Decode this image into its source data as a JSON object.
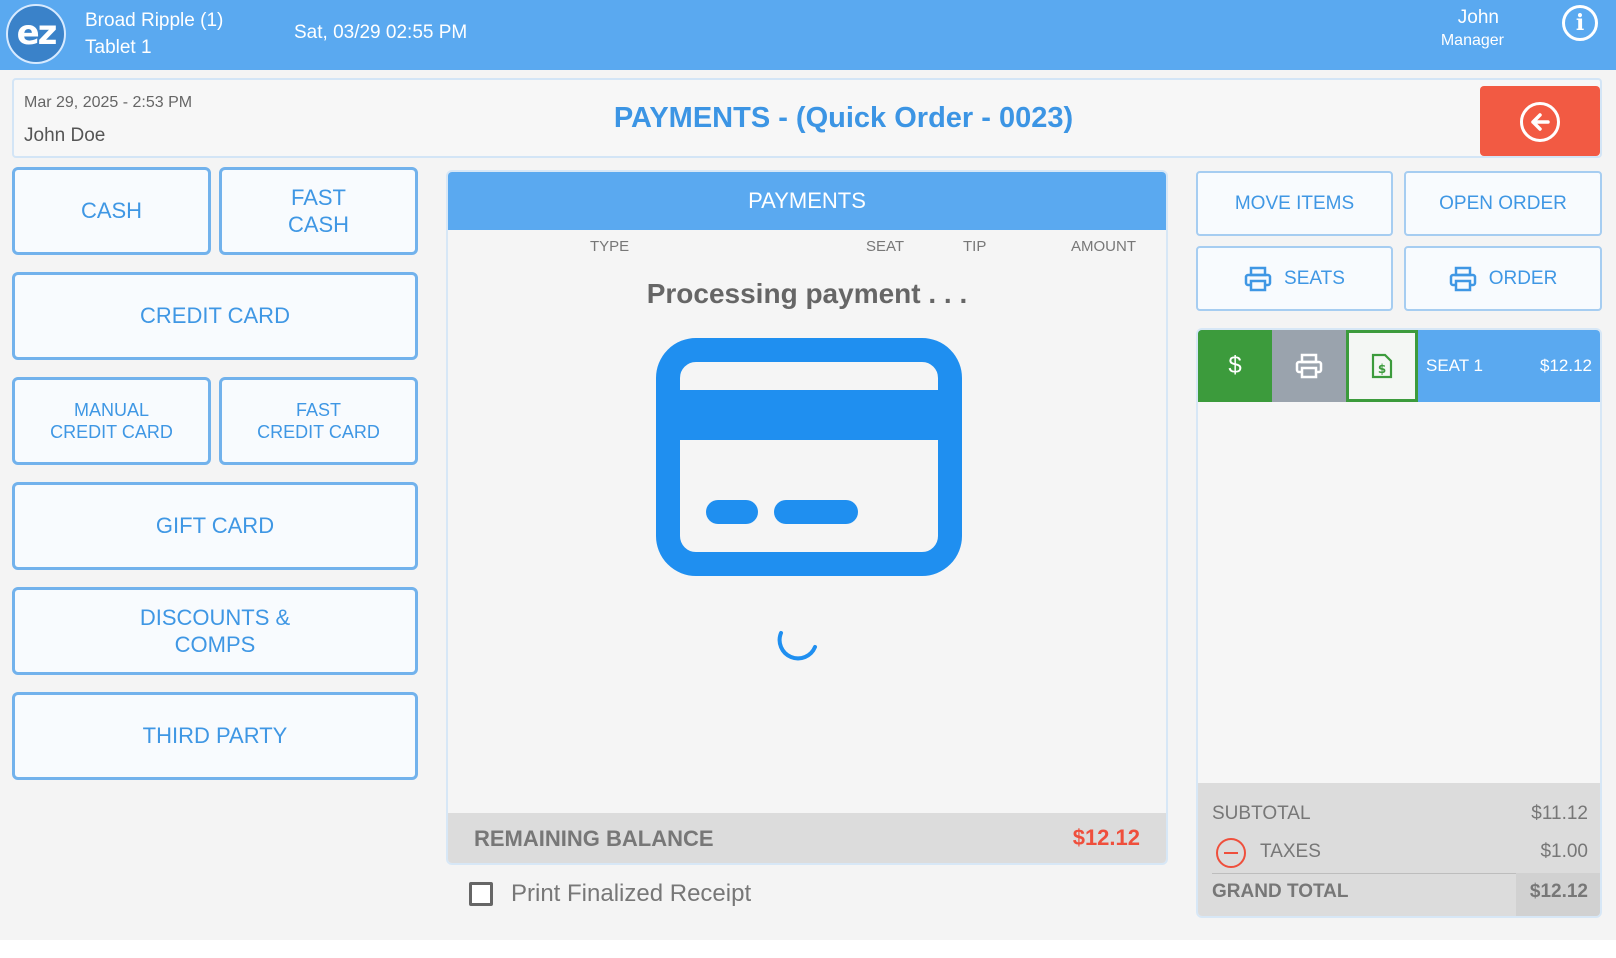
{
  "topbar": {
    "logo_text": "ez",
    "location": "Broad Ripple (1)",
    "device": "Tablet 1",
    "datetime": "Sat, 03/29 02:55 PM",
    "user_name": "John",
    "user_role": "Manager",
    "info_icon": "info-icon"
  },
  "header": {
    "order_date": "Mar 29, 2025  - 2:53 PM",
    "customer": "John Doe",
    "title": "PAYMENTS - (Quick Order - 0023)",
    "back_icon": "arrow-left-circle-icon",
    "back_color": "#f25a43"
  },
  "payment_methods": {
    "cash": "CASH",
    "fast_cash": "FAST\nCASH",
    "credit_card": "CREDIT CARD",
    "manual_credit_card": "MANUAL\nCREDIT CARD",
    "fast_credit_card": "FAST\nCREDIT CARD",
    "gift_card": "GIFT CARD",
    "discounts": "DISCOUNTS &\nCOMPS",
    "third_party": "THIRD PARTY"
  },
  "payments_panel": {
    "title": "PAYMENTS",
    "columns": {
      "type": "TYPE",
      "seat": "SEAT",
      "tip": "TIP",
      "amount": "AMOUNT"
    },
    "status": "Processing payment . . .",
    "status_icon": "credit-card-icon",
    "remaining_label": "REMAINING BALANCE",
    "remaining_value": "$12.12",
    "remaining_color": "#ef4f3c"
  },
  "print_receipt": {
    "label": "Print Finalized Receipt",
    "checked": false
  },
  "actions": {
    "move_items": "MOVE ITEMS",
    "open_order": "OPEN ORDER",
    "print_seats": "SEATS",
    "print_order": "ORDER",
    "print_icon": "printer-icon"
  },
  "seats": [
    {
      "pay_symbol": "$",
      "name": "SEAT 1",
      "amount": "$12.12",
      "pay_color": "#3c9b3c"
    }
  ],
  "totals": {
    "subtotal_label": "SUBTOTAL",
    "subtotal_value": "$11.12",
    "taxes_label": "TAXES",
    "taxes_value": "$1.00",
    "grand_total_label": "GRAND TOTAL",
    "grand_total_value": "$12.12"
  },
  "colors": {
    "accent": "#5aa9f0",
    "button_text": "#3f97e4"
  }
}
